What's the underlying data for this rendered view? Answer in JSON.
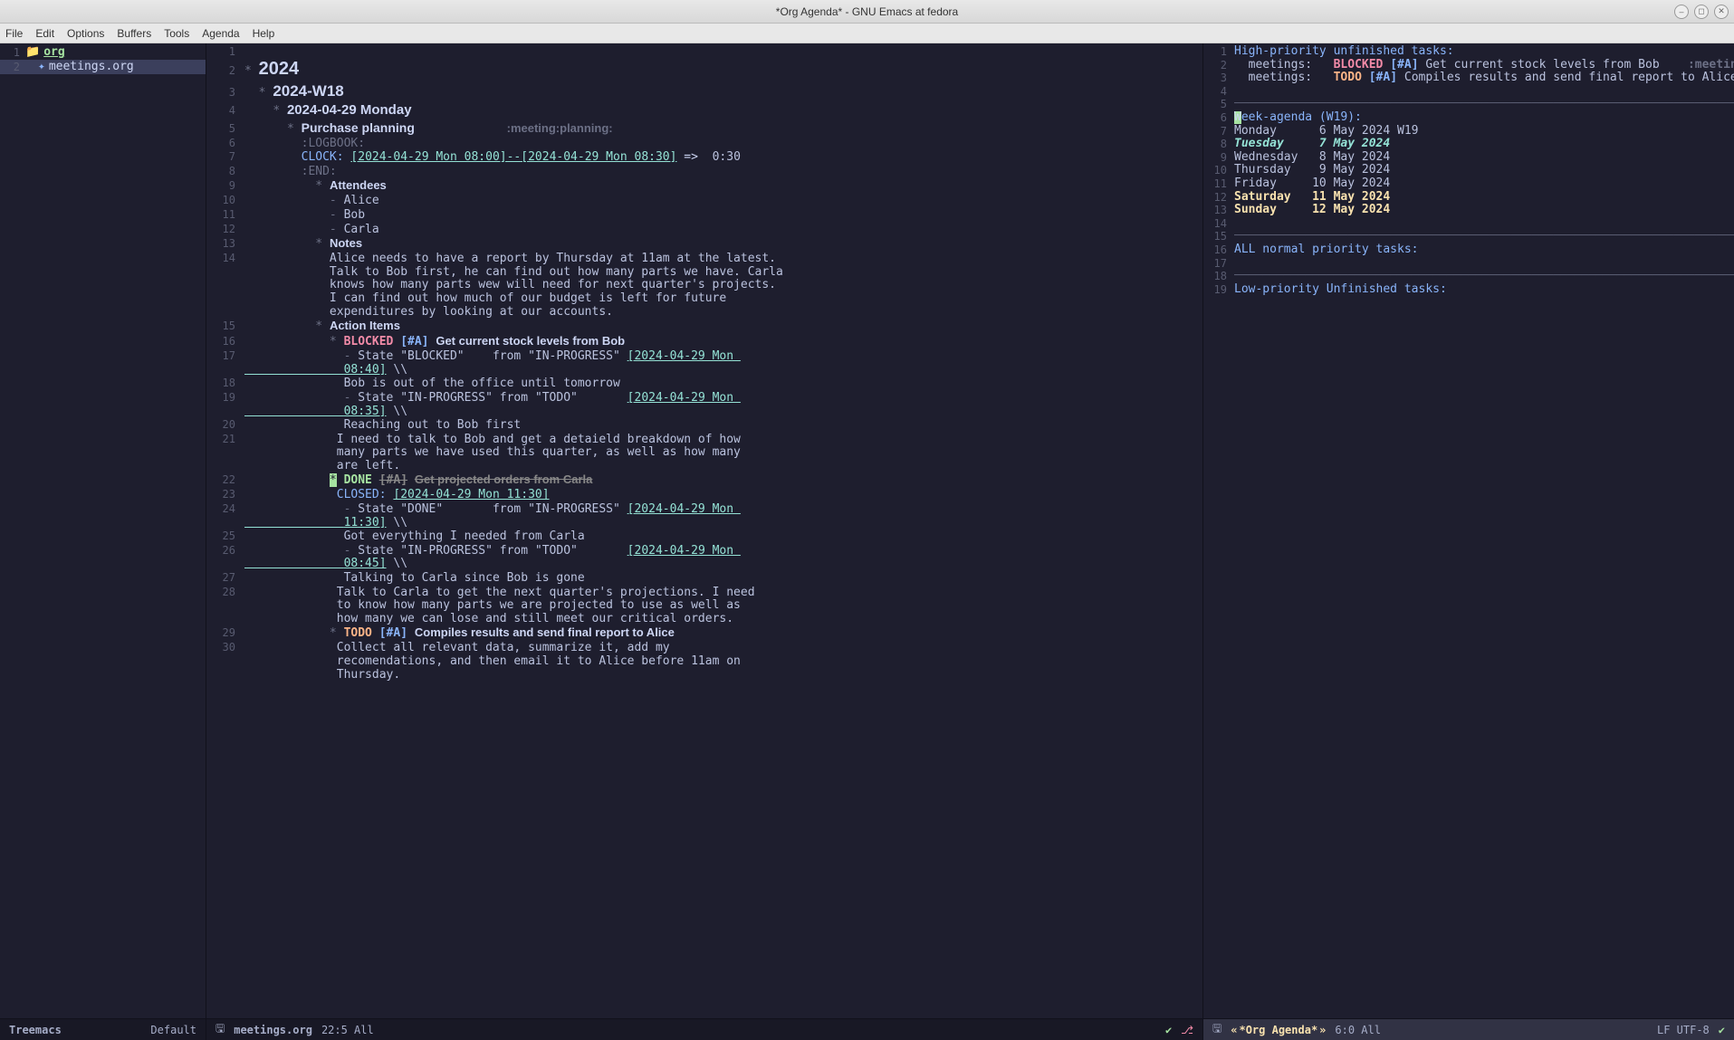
{
  "window": {
    "title": "*Org Agenda* - GNU Emacs at fedora"
  },
  "menubar": [
    "File",
    "Edit",
    "Options",
    "Buffers",
    "Tools",
    "Agenda",
    "Help"
  ],
  "treemacs": {
    "rows": [
      {
        "n": "1",
        "icon": "📁",
        "label": "org",
        "class": "tree-label"
      },
      {
        "n": "2",
        "icon": "✦",
        "label": "meetings.org",
        "selected": true
      }
    ],
    "modeline_left": "Treemacs",
    "modeline_right": "Default"
  },
  "org": {
    "modeline_buf": "meetings.org",
    "modeline_pos": "22:5 All",
    "lines": [
      {
        "n": "1",
        "cls": "line-body",
        "html": ""
      },
      {
        "n": "2",
        "cls": "line-h1",
        "html": "<span class='star'>*</span> <span class='h1'>2024</span>"
      },
      {
        "n": "3",
        "cls": "line-h2",
        "html": "  <span class='star'>*</span> <span class='h2'>2024-W18</span>"
      },
      {
        "n": "4",
        "cls": "line-h3",
        "html": "    <span class='star'>*</span> <span class='h3'>2024-04-29 Monday</span>"
      },
      {
        "n": "5",
        "cls": "line-h4",
        "html": "      <span class='star'>*</span> <span class='h4'>Purchase planning</span>             <span class='tags'>:meeting:planning:</span>"
      },
      {
        "n": "6",
        "cls": "line-body",
        "html": "        <span class='drawer'>:LOGBOOK:</span>"
      },
      {
        "n": "7",
        "cls": "line-body",
        "html": "        <span class='clock-kw'>CLOCK:</span> <span class='ts'>[2024-04-29 Mon 08:00]--[2024-04-29 Mon 08:30]</span> <span class='arrow'>=&gt;</span>  <span class='body'>0:30</span>"
      },
      {
        "n": "8",
        "cls": "line-body",
        "html": "        <span class='drawer'>:END:</span>"
      },
      {
        "n": "9",
        "cls": "line-h5",
        "html": "          <span class='star'>*</span> <span class='h5'>Attendees</span>"
      },
      {
        "n": "10",
        "cls": "line-body",
        "html": "            <span class='bullet'>-</span> <span class='body'>Alice</span>"
      },
      {
        "n": "11",
        "cls": "line-body",
        "html": "            <span class='bullet'>-</span> <span class='body'>Bob</span>"
      },
      {
        "n": "12",
        "cls": "line-body",
        "html": "            <span class='bullet'>-</span> <span class='body'>Carla</span>"
      },
      {
        "n": "13",
        "cls": "line-h5",
        "html": "          <span class='star'>*</span> <span class='h5'>Notes</span>"
      },
      {
        "n": "14",
        "cls": "line-body",
        "html": "            <span class='body'>Alice needs to have a report by Thursday at 11am at the latest.\n            Talk to Bob first, he can find out how many parts we have. Carla\n            knows how many parts wew will need for next quarter's projects.\n            I can find out how much of our budget is left for future\n            expenditures by looking at our accounts.</span>"
      },
      {
        "n": "15",
        "cls": "line-h5",
        "html": "          <span class='star'>*</span> <span class='h5'>Action Items</span>"
      },
      {
        "n": "16",
        "cls": "line-h5",
        "html": "            <span class='star'>*</span> <span class='blocked'>BLOCKED</span> <span class='priA'>[#A]</span> <span class='h5'>Get current stock levels from Bob</span>"
      },
      {
        "n": "17",
        "cls": "line-body",
        "html": "              <span class='bullet'>-</span> <span class='body'>State \"BLOCKED\"    from \"IN-PROGRESS\"</span> <span class='ts'>[2024-04-29 Mon \n              08:40]</span> <span class='body'>\\\\</span>"
      },
      {
        "n": "18",
        "cls": "line-body",
        "html": "              <span class='body'>Bob is out of the office until tomorrow</span>"
      },
      {
        "n": "19",
        "cls": "line-body",
        "html": "              <span class='bullet'>-</span> <span class='body'>State \"IN-PROGRESS\" from \"TODO\"</span>       <span class='ts'>[2024-04-29 Mon \n              08:35]</span> <span class='body'>\\\\</span>"
      },
      {
        "n": "20",
        "cls": "line-body",
        "html": "              <span class='body'>Reaching out to Bob first</span>"
      },
      {
        "n": "21",
        "cls": "line-body",
        "html": "             <span class='body'>I need to talk to Bob and get a detaield breakdown of how\n             many parts we have used this quarter, as well as how many\n             are left.</span>"
      },
      {
        "n": "22",
        "cls": "line-h5",
        "html": "            <span class='cursor-mark'>*</span> <span class='done'>DONE</span> <span class='priA strike'>[#A]</span> <span class='h5 strike'>Get projected orders from Carla</span>"
      },
      {
        "n": "23",
        "cls": "line-body",
        "html": "             <span class='closed-kw'>CLOSED:</span> <span class='ts'>[2024-04-29 Mon 11:30]</span>"
      },
      {
        "n": "24",
        "cls": "line-body",
        "html": "              <span class='bullet'>-</span> <span class='body'>State \"DONE\"       from \"IN-PROGRESS\"</span> <span class='ts'>[2024-04-29 Mon \n              11:30]</span> <span class='body'>\\\\</span>"
      },
      {
        "n": "25",
        "cls": "line-body",
        "html": "              <span class='body'>Got everything I needed from Carla</span>"
      },
      {
        "n": "26",
        "cls": "line-body",
        "html": "              <span class='bullet'>-</span> <span class='body'>State \"IN-PROGRESS\" from \"TODO\"</span>       <span class='ts'>[2024-04-29 Mon \n              08:45]</span> <span class='body'>\\\\</span>"
      },
      {
        "n": "27",
        "cls": "line-body",
        "html": "              <span class='body'>Talking to Carla since Bob is gone</span>"
      },
      {
        "n": "28",
        "cls": "line-body",
        "html": "             <span class='body'>Talk to Carla to get the next quarter's projections. I need\n             to know how many parts we are projected to use as well as\n             how many we can lose and still meet our critical orders.</span>"
      },
      {
        "n": "29",
        "cls": "line-h5",
        "html": "            <span class='star'>*</span> <span class='todo'>TODO</span> <span class='priA'>[#A]</span> <span class='h5'>Compiles results and send final report to Alice</span>"
      },
      {
        "n": "30",
        "cls": "line-body",
        "html": "             <span class='body'>Collect all relevant data, summarize it, add my\n             recomendations, and then email it to Alice before 11am on\n             Thursday.</span>"
      }
    ]
  },
  "agenda": {
    "modeline_buf": "*Org Agenda*",
    "modeline_pos": "6:0 All",
    "lines": [
      {
        "n": "1",
        "html": "<span class='ag-head'>High-priority unfinished tasks:</span>"
      },
      {
        "n": "2",
        "html": "  <span class='ag-cat'>meetings:</span>   <span class='blocked'>BLOCKED</span> <span class='priA'>[#A]</span> <span class='body'>Get current stock levels from Bob</span>    <span class='ag-tags'>:meeting:planning::</span>"
      },
      {
        "n": "3",
        "html": "  <span class='ag-cat'>meetings:</span>   <span class='todo'>TODO</span> <span class='priA'>[#A]</span> <span class='body'>Compiles results and send final report to Alice</span> <span class='ag-tags'>:meeting:pl</span>"
      },
      {
        "n": "4",
        "html": ""
      },
      {
        "n": "5",
        "html": "<span class='ag-rule'>─────────────────────────────────────────────────────────────────────────────────</span>"
      },
      {
        "n": "6",
        "html": "<span class='cursor-block'>W</span><span class='ag-head'>eek-agenda (W19):</span>"
      },
      {
        "n": "7",
        "html": "<span class='ag-day'>Monday      6 May 2024 W19</span>"
      },
      {
        "n": "8",
        "html": "<span class='ag-tue'>Tuesday     7 May 2024</span>"
      },
      {
        "n": "9",
        "html": "<span class='ag-day'>Wednesday   8 May 2024</span>"
      },
      {
        "n": "10",
        "html": "<span class='ag-day'>Thursday    9 May 2024</span>"
      },
      {
        "n": "11",
        "html": "<span class='ag-day'>Friday     10 May 2024</span>"
      },
      {
        "n": "12",
        "html": "<span class='ag-wk'>Saturday   11 May 2024</span>"
      },
      {
        "n": "13",
        "html": "<span class='ag-wk'>Sunday     12 May 2024</span>"
      },
      {
        "n": "14",
        "html": ""
      },
      {
        "n": "15",
        "html": "<span class='ag-rule'>─────────────────────────────────────────────────────────────────────────────────</span>"
      },
      {
        "n": "16",
        "html": "<span class='ag-head'>ALL normal priority tasks:</span>"
      },
      {
        "n": "17",
        "html": ""
      },
      {
        "n": "18",
        "html": "<span class='ag-rule'>─────────────────────────────────────────────────────────────────────────────────</span>"
      },
      {
        "n": "19",
        "html": "<span class='ag-low'>Low-priority Unfinished tasks:</span>"
      }
    ]
  },
  "modeline_common": {
    "encoding": "LF UTF-8"
  }
}
